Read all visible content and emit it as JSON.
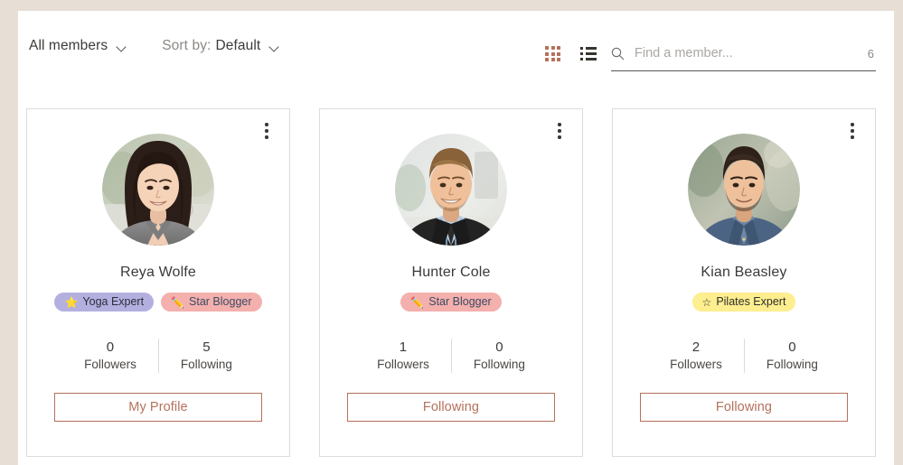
{
  "toolbar": {
    "filter_label": "All members",
    "sort_prefix": "Sort by:",
    "sort_value": "Default",
    "grid_view_icon": "grid-view-icon",
    "list_view_icon": "list-view-icon"
  },
  "search": {
    "placeholder": "Find a member...",
    "value": "",
    "count": "6",
    "icon": "search-icon"
  },
  "colors": {
    "accent": "#b5715b",
    "page_background": "#e7ded6",
    "card_border": "#dedbd8",
    "text_primary": "#3c3a38",
    "text_muted": "#8b8885",
    "badge_yoga_bg": "#b3b0e0",
    "badge_yoga_text": "#2c2c3a",
    "badge_blogger_bg": "#f3b0ad",
    "badge_blogger_text": "#3d4a63",
    "badge_pilates_bg": "#fdee8f",
    "badge_pilates_text": "#2f2d2a"
  },
  "members": [
    {
      "name": "Reya Wolfe",
      "menu_icon": "more-options-icon",
      "avatar_alt": "avatar-reya-wolfe",
      "badges": [
        {
          "icon": "star-filled",
          "glyph": "⭐",
          "label": "Yoga Expert",
          "style": "yoga"
        },
        {
          "icon": "pencil",
          "glyph": "✏️",
          "label": "Star Blogger",
          "style": "blogger"
        }
      ],
      "stats": [
        {
          "value": "0",
          "label": "Followers"
        },
        {
          "value": "5",
          "label": "Following"
        }
      ],
      "action_label": "My Profile"
    },
    {
      "name": "Hunter Cole",
      "menu_icon": "more-options-icon",
      "avatar_alt": "avatar-hunter-cole",
      "badges": [
        {
          "icon": "pencil",
          "glyph": "✏️",
          "label": "Star Blogger",
          "style": "blogger"
        }
      ],
      "stats": [
        {
          "value": "1",
          "label": "Followers"
        },
        {
          "value": "0",
          "label": "Following"
        }
      ],
      "action_label": "Following"
    },
    {
      "name": "Kian Beasley",
      "menu_icon": "more-options-icon",
      "avatar_alt": "avatar-kian-beasley",
      "badges": [
        {
          "icon": "star-outline",
          "glyph": "☆",
          "label": "Pilates Expert",
          "style": "pilates"
        }
      ],
      "stats": [
        {
          "value": "2",
          "label": "Followers"
        },
        {
          "value": "0",
          "label": "Following"
        }
      ],
      "action_label": "Following"
    }
  ]
}
